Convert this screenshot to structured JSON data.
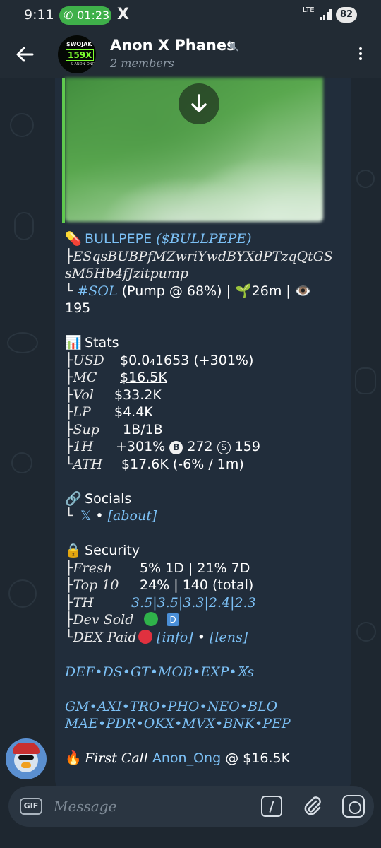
{
  "status_bar": {
    "time": "9:11",
    "call_timer": "01:23",
    "app_icon": "X",
    "network": "LTE",
    "battery": "82"
  },
  "header": {
    "title": "Anon X Phanes",
    "subtitle": "2 members",
    "avatar_text": [
      "$WOJAK",
      "159X",
      "& ANON_ONG"
    ]
  },
  "message": {
    "token_line": {
      "emoji": "💊",
      "name": "BULLPEPE",
      "ticker": "($BULLPEPE)"
    },
    "address_line1": "├ESqsBUBPfMZwriYwdBYXdPTzqQtGS",
    "address_line2": "sM5Hb4fJzitpump",
    "chain_line": {
      "prefix": "└ ",
      "chain": "#SOL",
      "text": " (Pump @ 68%) | 🌱26m | 👁️"
    },
    "views": "195",
    "stats": {
      "heading": "Stats",
      "icon": "📊",
      "rows": [
        {
          "key": "├USD",
          "value": "$0.0₄1653 (+301%)"
        },
        {
          "key": "├MC",
          "value": "$16.5K"
        },
        {
          "key": "├Vol",
          "value": "$33.2K"
        },
        {
          "key": "├LP",
          "value": "$4.4K"
        },
        {
          "key": "├Sup",
          "value": "1B/1B"
        },
        {
          "key": "├1H",
          "value": "+301%",
          "buys": "272",
          "sells": "159",
          "buy_icon": "B",
          "sell_icon": "S"
        },
        {
          "key": "└ATH",
          "value": "$17.6K (-6% / 1m)"
        }
      ]
    },
    "socials": {
      "heading": "Socials",
      "icon": "🔗",
      "prefix": "└",
      "x_link": "𝕏",
      "sep": "•",
      "about": "[about]"
    },
    "security": {
      "heading": "Security",
      "icon": "🔒",
      "fresh_key": "├Fresh",
      "fresh_value": "5% 1D | 21% 7D",
      "top10_key": "├Top 10",
      "top10_value": "24% | 140 (total)",
      "th_key": "├TH",
      "th_value": "3.5|3.5|3.3|2.4|2.3",
      "dev_key": "├Dev Sold",
      "dev_badge": "D",
      "dex_key": "└DEX Paid",
      "dex_info": "[info]",
      "dex_sep": "•",
      "dex_lens": "[lens]"
    },
    "links1": "DEF•DS•GT•MOB•EXP•𝕏s",
    "links2a": "GM•AXI•TRO•PHO•NEO•BLO",
    "links2b": "MAE•PDR•OKX•MVX•BNK•PEP",
    "first_call": {
      "emoji": "🔥",
      "label": "First Call",
      "user": "Anon_Ong",
      "at": "@ $16.5K"
    }
  },
  "input": {
    "gif_label": "GIF",
    "placeholder": "Message"
  },
  "colors": {
    "bg": "#1e2730",
    "bubble": "#212d3b",
    "link": "#7cc0f5",
    "accent_green": "#5fc94e"
  }
}
